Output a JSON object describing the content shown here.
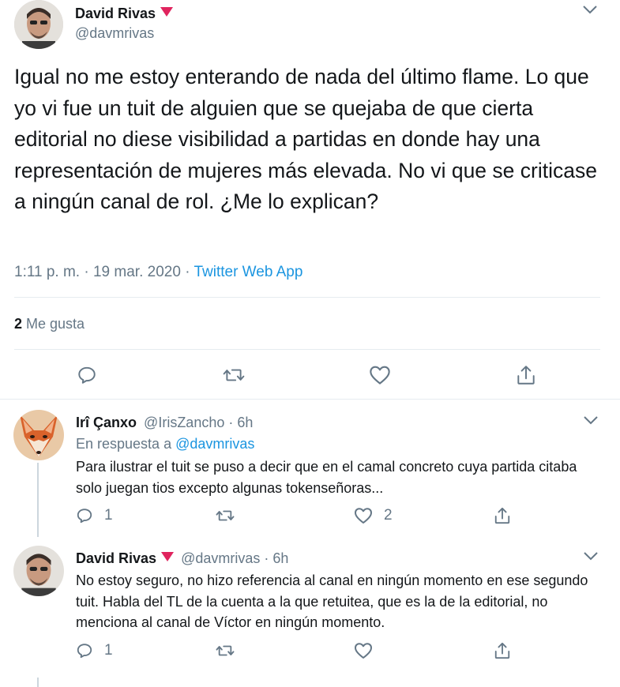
{
  "main_tweet": {
    "author_name": "David Rivas",
    "handle": "@davmrivas",
    "text": "Igual no me estoy enterando de nada del último flame. Lo que yo vi fue un tuit de alguien que se quejaba de que cierta editorial no diese visibilidad a partidas en donde hay una representación de mujeres más elevada. No vi que se criticase a ningún canal de rol. ¿Me lo explican?",
    "time": "1:11 p. m.",
    "date": "19 mar. 2020",
    "source": "Twitter Web App",
    "likes_count": "2",
    "likes_label": "Me gusta"
  },
  "replies": [
    {
      "author_name": "Irî Çanxo",
      "handle": "@IrisZancho",
      "time_ago": "6h",
      "in_reply_label": "En respuesta a",
      "in_reply_handle": "@davmrivas",
      "text": "Para ilustrar el tuit se puso a decir que en el camal concreto cuya partida citaba solo juegan tios excepto algunas tokenseñoras...",
      "reply_count": "1",
      "like_count": "2"
    },
    {
      "author_name": "David Rivas",
      "handle": "@davmrivas",
      "time_ago": "6h",
      "text": "No estoy seguro, no hizo referencia al canal en ningún momento en ese segundo tuit. Habla del TL de la cuenta a la que retuitea, que es la de la editorial, no menciona al canal de Víctor en ningún momento.",
      "reply_count": "1"
    }
  ],
  "separator": "·",
  "colors": {
    "link": "#1b95e0",
    "muted": "#657786",
    "verified_flag": "#e0245e",
    "divider": "#e6ecf0"
  }
}
